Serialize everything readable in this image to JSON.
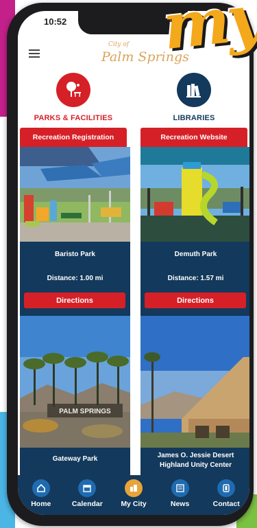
{
  "status": {
    "time": "10:52"
  },
  "header": {
    "logo_top": "City of",
    "logo_main": "Palm Springs",
    "menu_icon": "hamburger-menu-icon"
  },
  "promo": {
    "text": "my"
  },
  "categories": [
    {
      "label": "PARKS & FACILITIES",
      "icon": "park-bench-tree-icon",
      "color": "#d62027",
      "button": "Recreation Registration"
    },
    {
      "label": "LIBRARIES",
      "icon": "library-books-icon",
      "color": "#13395c",
      "button": "Recreation Website"
    }
  ],
  "parks": [
    {
      "name": "Baristo Park",
      "distance": "Distance: 1.00 mi",
      "directions": "Directions"
    },
    {
      "name": "Demuth Park",
      "distance": "Distance: 1.57 mi",
      "directions": "Directions"
    },
    {
      "name": "Gateway Park",
      "sign": "PALM SPRINGS"
    },
    {
      "name": "James O. Jessie Desert Highland Unity Center"
    }
  ],
  "nav": [
    {
      "label": "Home",
      "icon": "home-icon"
    },
    {
      "label": "Calendar",
      "icon": "calendar-icon"
    },
    {
      "label": "My City",
      "icon": "my-city-icon",
      "active": true
    },
    {
      "label": "News",
      "icon": "news-icon"
    },
    {
      "label": "Contact",
      "icon": "contact-icon"
    }
  ],
  "colors": {
    "red": "#d62027",
    "navy": "#13395c",
    "blue": "#1f6bb0",
    "gold": "#e8a33a"
  }
}
